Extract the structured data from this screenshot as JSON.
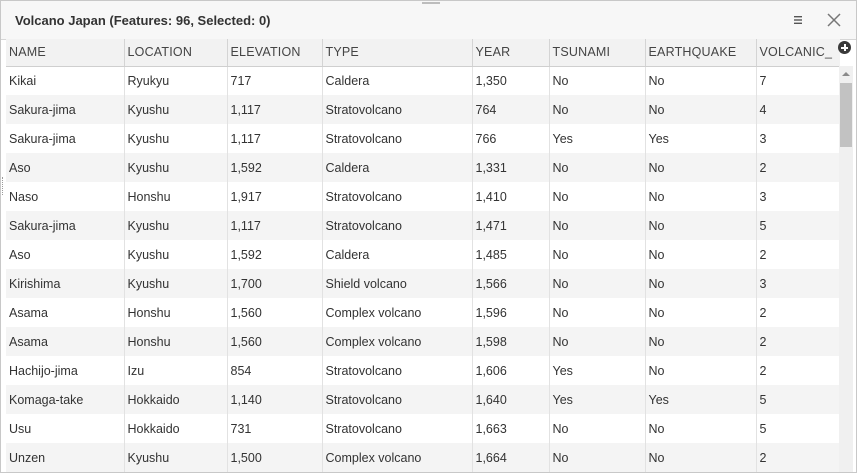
{
  "panel": {
    "title": "Volcano Japan (Features: 96, Selected: 0)",
    "menu_icon": "hamburger-menu-icon",
    "close_icon": "close-icon"
  },
  "table": {
    "columns": [
      "NAME",
      "LOCATION",
      "ELEVATION",
      "TYPE",
      "YEAR",
      "TSUNAMI",
      "EARTHQUAKE",
      "VOLCANIC_"
    ],
    "rows": [
      [
        "Kikai",
        "Ryukyu",
        "717",
        "Caldera",
        "1,350",
        "No",
        "No",
        "7"
      ],
      [
        "Sakura-jima",
        "Kyushu",
        "1,117",
        "Stratovolcano",
        "764",
        "No",
        "No",
        "4"
      ],
      [
        "Sakura-jima",
        "Kyushu",
        "1,117",
        "Stratovolcano",
        "766",
        "Yes",
        "Yes",
        "3"
      ],
      [
        "Aso",
        "Kyushu",
        "1,592",
        "Caldera",
        "1,331",
        "No",
        "No",
        "2"
      ],
      [
        "Naso",
        "Honshu",
        "1,917",
        "Stratovolcano",
        "1,410",
        "No",
        "No",
        "3"
      ],
      [
        "Sakura-jima",
        "Kyushu",
        "1,117",
        "Stratovolcano",
        "1,471",
        "No",
        "No",
        "5"
      ],
      [
        "Aso",
        "Kyushu",
        "1,592",
        "Caldera",
        "1,485",
        "No",
        "No",
        "2"
      ],
      [
        "Kirishima",
        "Kyushu",
        "1,700",
        "Shield volcano",
        "1,566",
        "No",
        "No",
        "3"
      ],
      [
        "Asama",
        "Honshu",
        "1,560",
        "Complex volcano",
        "1,596",
        "No",
        "No",
        "2"
      ],
      [
        "Asama",
        "Honshu",
        "1,560",
        "Complex volcano",
        "1,598",
        "No",
        "No",
        "2"
      ],
      [
        "Hachijo-jima",
        "Izu",
        "854",
        "Stratovolcano",
        "1,606",
        "Yes",
        "No",
        "2"
      ],
      [
        "Komaga-take",
        "Hokkaido",
        "1,140",
        "Stratovolcano",
        "1,640",
        "Yes",
        "Yes",
        "5"
      ],
      [
        "Usu",
        "Hokkaido",
        "731",
        "Stratovolcano",
        "1,663",
        "No",
        "No",
        "5"
      ],
      [
        "Unzen",
        "Kyushu",
        "1,500",
        "Complex volcano",
        "1,664",
        "No",
        "No",
        "2"
      ]
    ]
  },
  "controls": {
    "add_column_icon": "plus-circle-icon",
    "scroll_up_icon": "scroll-up-arrow-icon"
  }
}
